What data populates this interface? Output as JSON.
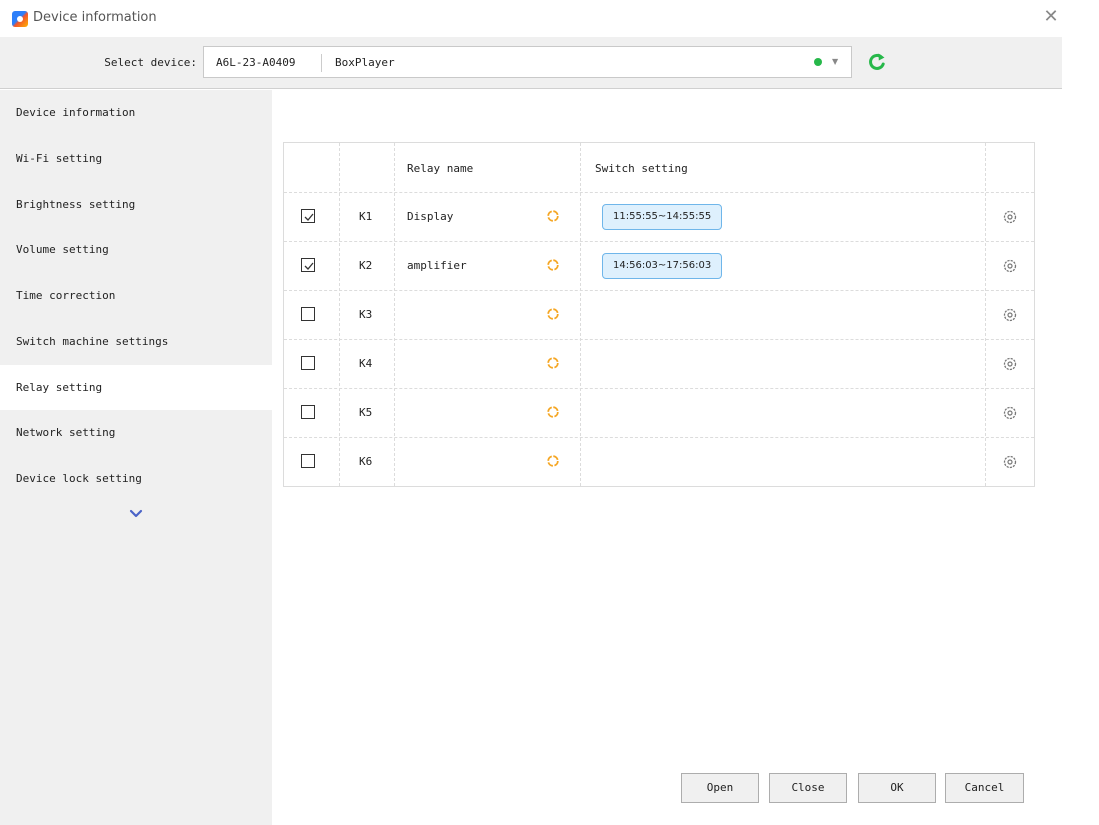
{
  "window": {
    "title": "Device information"
  },
  "device_bar": {
    "label": "Select device:",
    "device_id": "A6L-23-A0409",
    "device_name": "BoxPlayer",
    "status_color": "#27b84a"
  },
  "sidebar": {
    "items": [
      {
        "label": "Device information"
      },
      {
        "label": "Wi-Fi setting"
      },
      {
        "label": "Brightness setting"
      },
      {
        "label": "Volume setting"
      },
      {
        "label": "Time correction"
      },
      {
        "label": "Switch machine settings"
      },
      {
        "label": "Relay setting",
        "active": true
      },
      {
        "label": "Network setting"
      },
      {
        "label": "Device lock setting"
      }
    ]
  },
  "table": {
    "headers": {
      "relay_name": "Relay name",
      "switch_setting": "Switch setting"
    },
    "rows": [
      {
        "checked": true,
        "id": "K1",
        "name": "Display",
        "schedule": "11:55:55~14:55:55"
      },
      {
        "checked": true,
        "id": "K2",
        "name": "amplifier",
        "schedule": "14:56:03~17:56:03"
      },
      {
        "checked": false,
        "id": "K3",
        "name": "",
        "schedule": ""
      },
      {
        "checked": false,
        "id": "K4",
        "name": "",
        "schedule": ""
      },
      {
        "checked": false,
        "id": "K5",
        "name": "",
        "schedule": ""
      },
      {
        "checked": false,
        "id": "K6",
        "name": "",
        "schedule": ""
      }
    ]
  },
  "buttons": {
    "open": "Open",
    "close": "Close",
    "ok": "OK",
    "cancel": "Cancel"
  },
  "colors": {
    "accent": "#2d7ff9",
    "spinner": "#f5a623",
    "badge_bg": "#def0fd",
    "badge_border": "#6fb6ea",
    "refresh": "#27b84a"
  },
  "icons": [
    "app-icon",
    "close-icon",
    "refresh-icon",
    "chevron-down-icon",
    "spinner-icon",
    "gear-icon",
    "checkbox-icon"
  ]
}
